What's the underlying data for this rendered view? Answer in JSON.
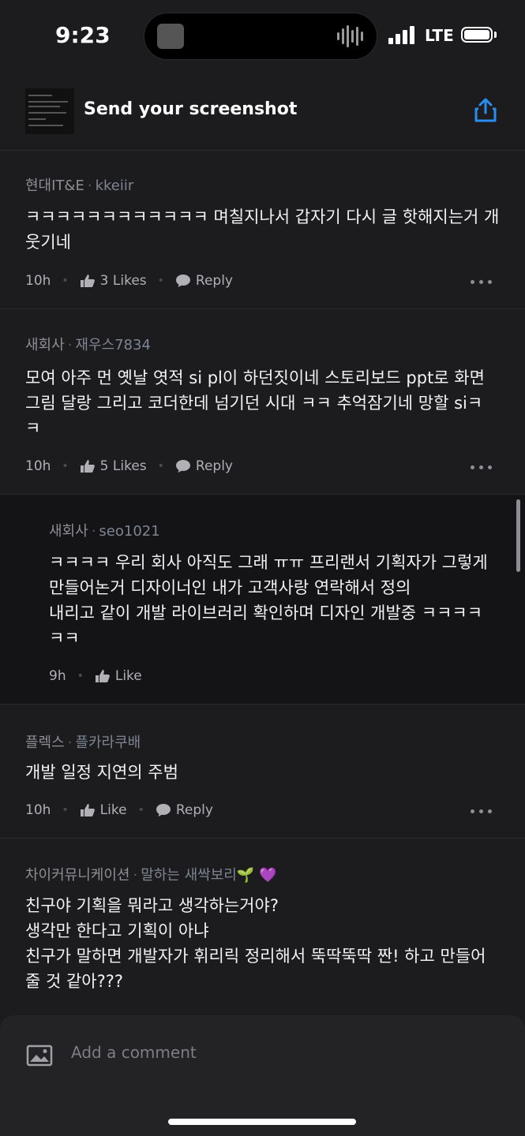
{
  "status": {
    "time": "9:23",
    "network": "LTE"
  },
  "header": {
    "title": "Send your screenshot"
  },
  "comments": [
    {
      "company": "현대IT&E",
      "nickname": "kkeiir",
      "text": "ㅋㅋㅋㅋㅋㅋㅋㅋㅋㅋㅋㅋ 며칠지나서 갑자기 다시 글 핫해지는거 개 웃기네",
      "time": "10h",
      "likes": "3 Likes",
      "reply": "Reply"
    },
    {
      "company": "새회사",
      "nickname": "재우스7834",
      "text": "모여 아주 먼 옛날 엿적 si pl이 하던짓이네 스토리보드 ppt로 화면 그림 달랑 그리고 코더한데 넘기던 시대 ㅋㅋ 추억잠기네 망할 siㅋ ㅋ",
      "time": "10h",
      "likes": "5 Likes",
      "reply": "Reply"
    },
    {
      "company": "새회사",
      "nickname": "seo1021",
      "text_lines": [
        "ㅋㅋㅋㅋ 우리 회사 아직도 그래 ㅠㅠ 프리랜서 기획자가 그렇게",
        "만들어논거 디자이너인 내가 고객사랑 연락해서 정의",
        "내리고 같이 개발 라이브러리 확인하며 디자인 개발중 ㅋㅋㅋㅋ",
        "ㅋㅋ"
      ],
      "time": "9h",
      "likes": "Like"
    },
    {
      "company": "플렉스",
      "nickname": "플카라쿠배",
      "text": "개발 일정 지연의 주범",
      "time": "10h",
      "likes": "Like",
      "reply": "Reply"
    },
    {
      "company": "차이커뮤니케이션",
      "nickname": "말하는 새싹보리🌱 💜",
      "text_lines": [
        "친구야 기획을 뭐라고 생각하는거야?",
        "생각만 한다고 기획이 아냐",
        "친구가 말하면 개발자가 휘리릭 정리해서 뚝딱뚝딱 짠! 하고 만들어",
        "줄 것 같아???"
      ]
    }
  ],
  "input": {
    "placeholder": "Add a comment"
  },
  "icons": [
    "share-icon",
    "like-icon",
    "reply-icon",
    "more-icon",
    "image-icon"
  ],
  "colors": {
    "background": "#1c1c1e",
    "reply_background": "#141416",
    "accent": "#2a8cf0",
    "nickname": "#7d8593"
  }
}
